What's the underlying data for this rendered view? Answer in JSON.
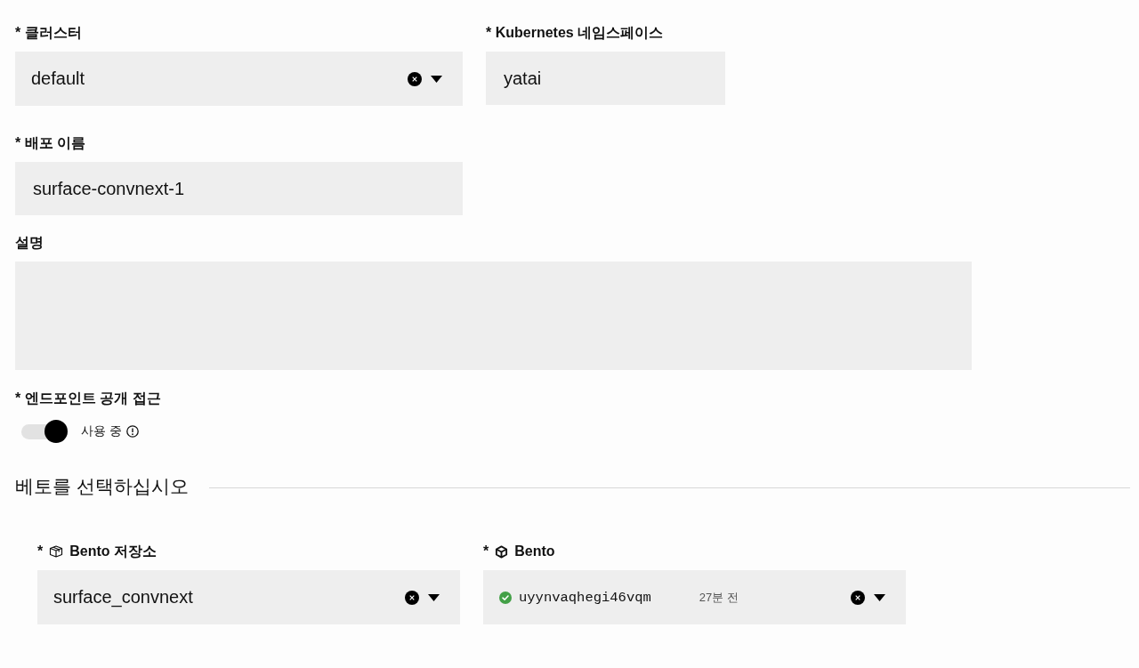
{
  "deployment_form": {
    "cluster": {
      "label": "* 클러스터",
      "value": "default"
    },
    "namespace": {
      "label": "* Kubernetes 네임스페이스",
      "value": "yatai"
    },
    "deployment_name": {
      "label": "* 배포 이름",
      "value": "surface-convnext-1"
    },
    "description": {
      "label": "설명"
    },
    "endpoint_public_access": {
      "label": "* 엔드포인트 공개 접근",
      "on": true,
      "status_text": "사용 중"
    }
  },
  "bento_section": {
    "title": "베토를 선택하십시오",
    "repository": {
      "required_mark": "*",
      "label": "Bento 저장소",
      "value": "surface_convnext"
    },
    "bento": {
      "required_mark": "*",
      "label": "Bento",
      "ready": true,
      "version": "uyynvaqhegi46vqm",
      "age": "27분 전"
    }
  }
}
